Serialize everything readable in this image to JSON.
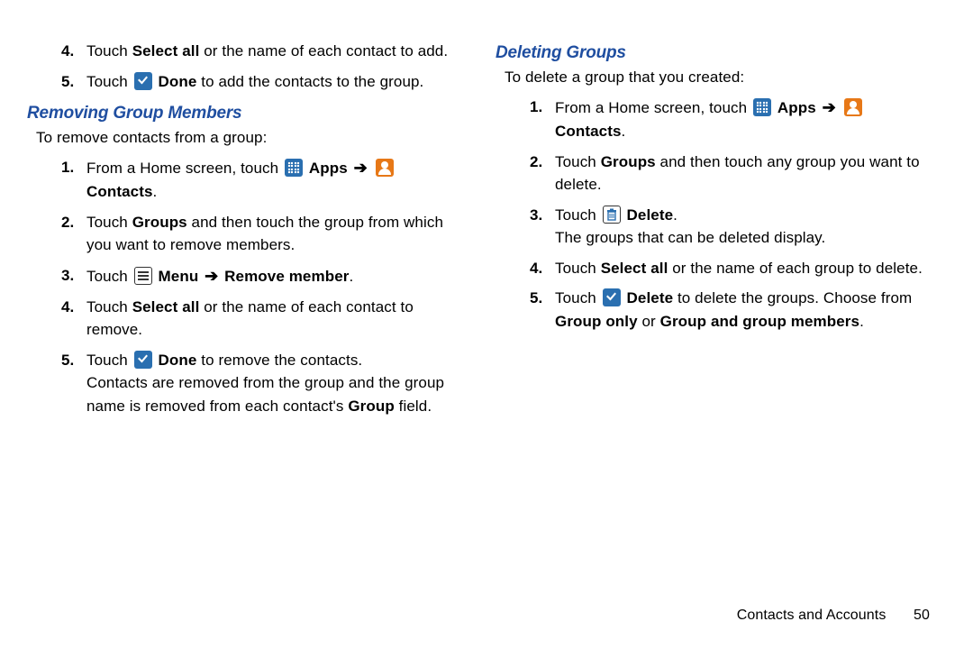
{
  "left": {
    "pre_steps": {
      "4": {
        "a": "Touch ",
        "b": "Select all",
        "c": " or the name of each contact to add."
      },
      "5": {
        "a": "Touch ",
        "b": "Done",
        "c": " to add the contacts to the group."
      }
    },
    "heading": "Removing Group Members",
    "intro": "To remove contacts from a group:",
    "steps": {
      "1": {
        "a": "From a Home screen, touch ",
        "apps": "Apps",
        "contacts": "Contacts",
        "dot": "."
      },
      "2": {
        "a": "Touch ",
        "b": "Groups",
        "c": " and then touch the group from which you want to remove members."
      },
      "3": {
        "a": "Touch ",
        "b": "Menu",
        "c": "Remove member",
        "dot": "."
      },
      "4": {
        "a": "Touch ",
        "b": "Select all",
        "c": " or the name of each contact to remove."
      },
      "5": {
        "a": "Touch ",
        "b": "Done",
        "c": " to remove the contacts.",
        "sub": "Contacts are removed from the group and the group name is removed from each contact's ",
        "d": "Group",
        "e": " field."
      }
    }
  },
  "right": {
    "heading": "Deleting Groups",
    "intro": "To delete a group that you created:",
    "steps": {
      "1": {
        "a": "From a Home screen, touch ",
        "apps": "Apps",
        "contacts": "Contacts",
        "dot": "."
      },
      "2": {
        "a": "Touch ",
        "b": "Groups",
        "c": " and then touch any group you want to delete."
      },
      "3": {
        "a": "Touch ",
        "b": "Delete",
        "dot": ".",
        "sub": "The groups that can be deleted display."
      },
      "4": {
        "a": "Touch ",
        "b": "Select all",
        "c": " or the name of each group to delete."
      },
      "5": {
        "a": "Touch ",
        "b": "Delete",
        "c": " to delete the groups. Choose from ",
        "d": "Group only",
        "e": " or ",
        "f": "Group and group members",
        "dot": "."
      }
    }
  },
  "footer": {
    "section": "Contacts and Accounts",
    "page": "50"
  }
}
